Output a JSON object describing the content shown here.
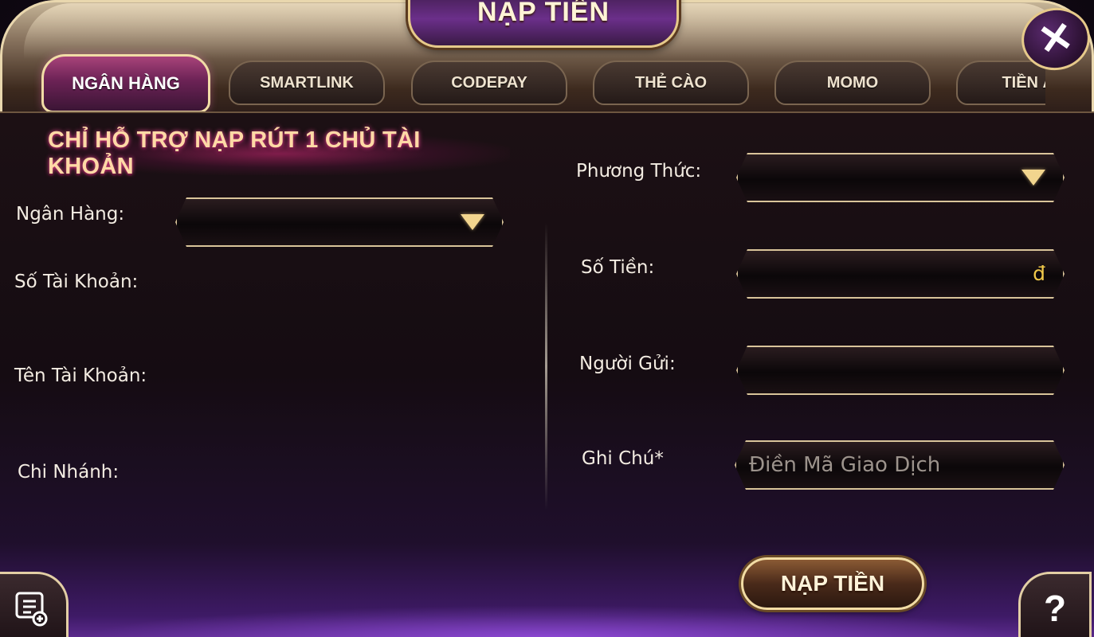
{
  "dialog": {
    "title": "NẠP TIỀN",
    "close_icon": "close-icon"
  },
  "tabs": [
    {
      "label": "NGÂN HÀNG",
      "active": true
    },
    {
      "label": "SMARTLINK",
      "active": false
    },
    {
      "label": "CODEPAY",
      "active": false
    },
    {
      "label": "THẺ CÀO",
      "active": false
    },
    {
      "label": "MOMO",
      "active": false
    },
    {
      "label": "TIỀN ẢO",
      "active": false
    }
  ],
  "notice": "CHỈ HỖ TRỢ NẠP RÚT 1 CHỦ TÀI KHOẢN",
  "left": {
    "bank_label": "Ngân Hàng:",
    "bank_value": "",
    "account_number_label": "Số Tài Khoản:",
    "account_name_label": "Tên Tài Khoản:",
    "branch_label": "Chi Nhánh:"
  },
  "right": {
    "method_label": "Phương Thức:",
    "method_value": "",
    "amount_label": "Số Tiền:",
    "amount_currency": "đ",
    "sender_label": "Người Gửi:",
    "note_label": "Ghi Chú*",
    "note_placeholder": "Điền Mã Giao Dịch"
  },
  "submit_label": "NẠP TIỀN",
  "help_glyph": "?",
  "colors": {
    "gold": "#e6c98a",
    "active_tab": "#8a3168",
    "panel": "#150c12",
    "purple_glow": "#5a2a8c",
    "currency": "#f0c84a"
  }
}
